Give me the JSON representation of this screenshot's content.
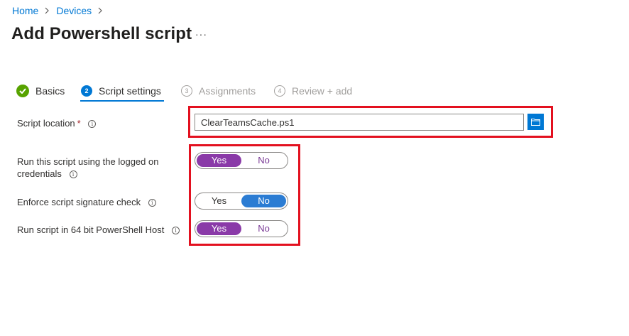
{
  "breadcrumb": {
    "items": [
      {
        "label": "Home"
      },
      {
        "label": "Devices"
      }
    ]
  },
  "page": {
    "title": "Add Powershell script",
    "more_label": "···"
  },
  "wizard": {
    "steps": [
      {
        "number": "",
        "label": "Basics",
        "state": "completed"
      },
      {
        "number": "2",
        "label": "Script settings",
        "state": "active"
      },
      {
        "number": "3",
        "label": "Assignments",
        "state": "pending"
      },
      {
        "number": "4",
        "label": "Review + add",
        "state": "pending"
      }
    ]
  },
  "form": {
    "script_location": {
      "label": "Script location",
      "required_marker": "*",
      "value": "ClearTeamsCache.ps1"
    },
    "run_as_logged_on": {
      "label_line1": "Run this script using the logged on",
      "label_line2": "credentials",
      "yes": "Yes",
      "no": "No",
      "selected": "Yes"
    },
    "enforce_signature": {
      "label": "Enforce script signature check",
      "yes": "Yes",
      "no": "No",
      "selected": "No"
    },
    "run_64bit": {
      "label": "Run script in 64 bit PowerShell Host",
      "yes": "Yes",
      "no": "No",
      "selected": "Yes"
    }
  },
  "icons": {
    "info": "info-icon",
    "browse": "folder-icon",
    "check": "checkmark-icon",
    "chevron": "chevron-right-icon"
  },
  "colors": {
    "accent": "#0078d4",
    "success": "#57a300",
    "toggle_purple": "#8a3aa8",
    "toggle_blue": "#2b7cd3",
    "highlight_red": "#e3101f",
    "required": "#a4262c"
  }
}
